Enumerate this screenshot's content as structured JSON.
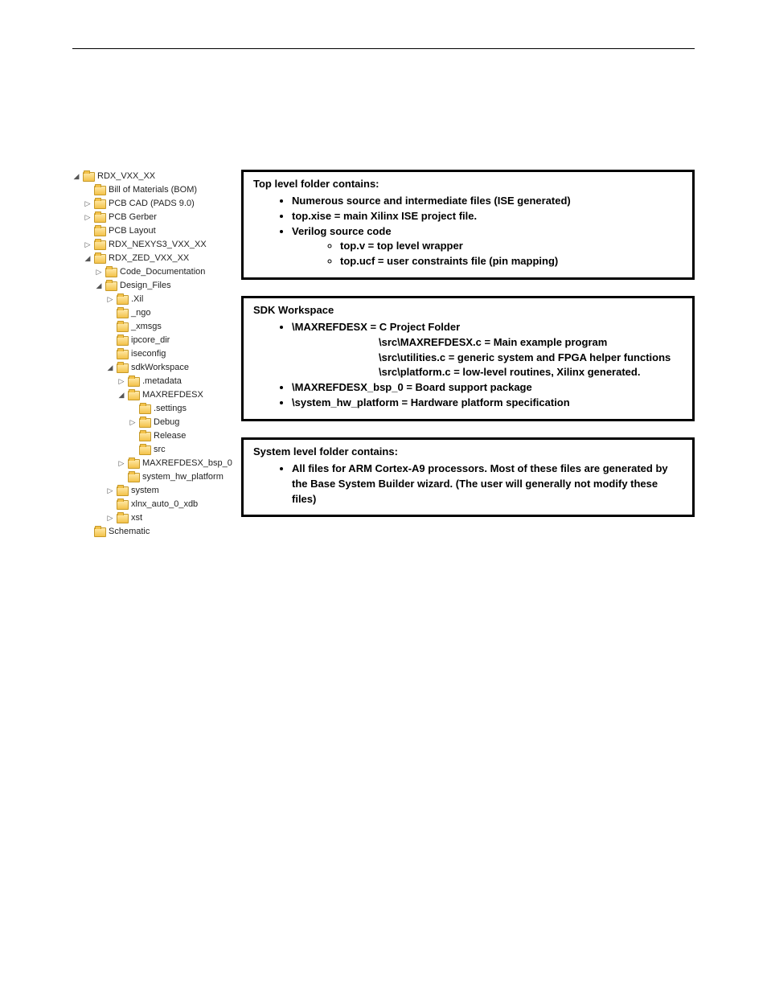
{
  "tree": {
    "n0": "RDX_VXX_XX",
    "n0a": "Bill of Materials (BOM)",
    "n0b": "PCB CAD (PADS 9.0)",
    "n0c": "PCB Gerber",
    "n0d": "PCB Layout",
    "n0e": "RDX_NEXYS3_VXX_XX",
    "n0f": "RDX_ZED_VXX_XX",
    "n0f_a": "Code_Documentation",
    "n0f_b": "Design_Files",
    "df_xil": ".Xil",
    "df_ngo": "_ngo",
    "df_xmsgs": "_xmsgs",
    "df_ipcore": "ipcore_dir",
    "df_iseconfig": "iseconfig",
    "df_sdk": "sdkWorkspace",
    "sdk_meta": ".metadata",
    "sdk_mrd": "MAXREFDESX",
    "mrd_settings": ".settings",
    "mrd_debug": "Debug",
    "mrd_release": "Release",
    "mrd_src": "src",
    "sdk_bsp": "MAXREFDESX_bsp_0",
    "sdk_hw": "system_hw_platform",
    "df_system": "system",
    "df_xlnx": "xlnx_auto_0_xdb",
    "df_xst": "xst",
    "n0g": "Schematic"
  },
  "box1": {
    "title": "Top level folder contains:",
    "b1": "Numerous source and intermediate files (ISE generated)",
    "b2": "top.xise = main Xilinx ISE project file.",
    "b3": "Verilog source code",
    "b3a": "top.v = top level wrapper",
    "b3b": "top.ucf = user constraints file (pin mapping)"
  },
  "box2": {
    "title": "SDK Workspace",
    "b1": "\\MAXREFDESX = C Project Folder",
    "b1a": "\\src\\MAXREFDESX.c  = Main example program",
    "b1b": "\\src\\utilities.c = generic system and FPGA helper functions",
    "b1c": "\\src\\platform.c = low-level routines, Xilinx generated.",
    "b2": "\\MAXREFDESX_bsp_0 = Board support package",
    "b3": "\\system_hw_platform =  Hardware platform specification"
  },
  "box3": {
    "title": "System level folder contains:",
    "b1": "All files for ARM Cortex-A9 processors. Most of these files are generated by the  Base System Builder wizard. (The user will generally not modify these files)"
  }
}
